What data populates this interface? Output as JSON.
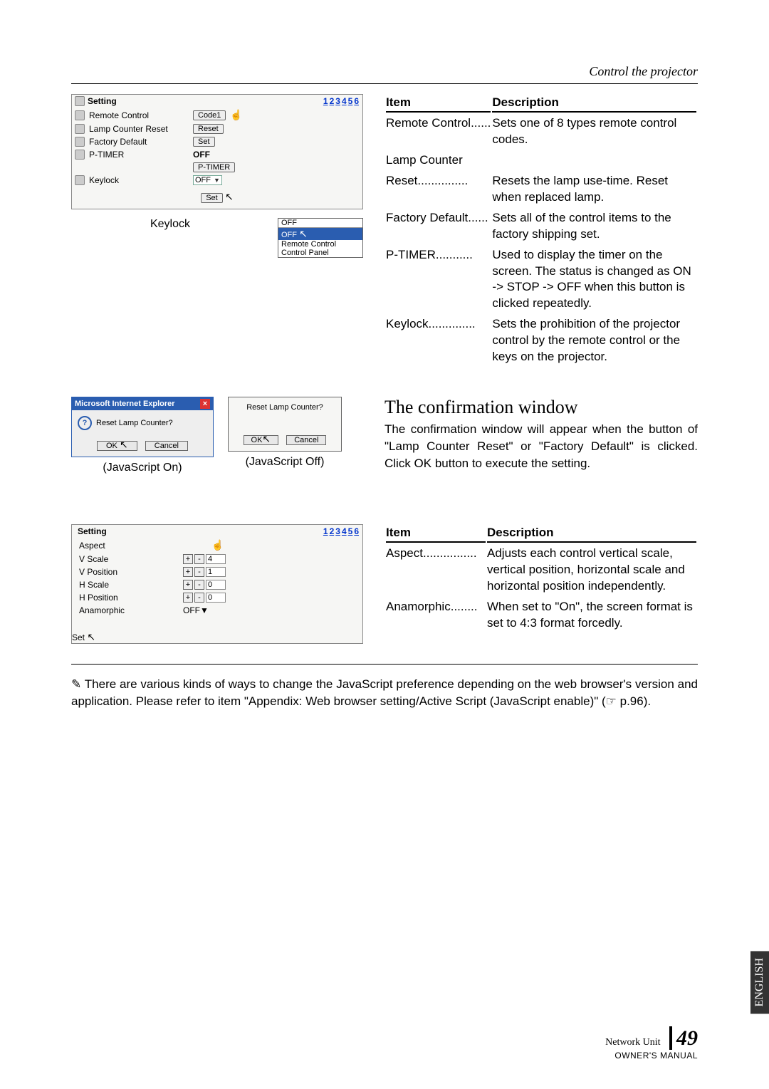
{
  "header": {
    "section": "Control the projector"
  },
  "shot1": {
    "title": "Setting",
    "pages": [
      "1",
      "2",
      "3",
      "4",
      "5",
      "6"
    ],
    "rows": {
      "remote_control": {
        "label": "Remote Control",
        "button": "Code1"
      },
      "lamp_counter_reset": {
        "label": "Lamp Counter Reset",
        "button": "Reset"
      },
      "factory_default": {
        "label": "Factory Default",
        "button": "Set"
      },
      "ptimer": {
        "label": "P-TIMER",
        "status": "OFF",
        "button": "P-TIMER"
      },
      "keylock": {
        "label": "Keylock",
        "value": "OFF"
      }
    },
    "set_button": "Set",
    "keylock_sub": {
      "label": "Keylock",
      "selected": "OFF",
      "options": [
        "OFF",
        "OFF",
        "Remote Control",
        "Control Panel"
      ]
    }
  },
  "table1": {
    "head_item": "Item",
    "head_desc": "Description",
    "rows": [
      {
        "item": "Remote Control",
        "dots": "......",
        "desc": "Sets one of 8 types remote control codes."
      },
      {
        "item": "Lamp Counter",
        "dots": "",
        "desc": ""
      },
      {
        "item": "Reset",
        "dots": "...............",
        "desc": "Resets the lamp use-time. Reset when replaced lamp."
      },
      {
        "item": "Factory Default",
        "dots": "......",
        "desc": "Sets all of the control items to the factory shipping set."
      },
      {
        "item": "P-TIMER",
        "dots": "...........",
        "desc": "Used to display the timer on the screen. The status is changed as ON -> STOP -> OFF when this button is clicked repeatedly."
      },
      {
        "item": "Keylock",
        "dots": "..............",
        "desc": "Sets the prohibition of the projector control by the remote control or the keys on the projector."
      }
    ]
  },
  "confirm": {
    "title": "The confirmation window",
    "body": "The confirmation window will appear when the button of \"Lamp Counter Reset\" or \"Factory Default\" is clicked. Click OK button to execute the setting.",
    "dlg_js": {
      "title": "Microsoft Internet Explorer",
      "msg": "Reset Lamp Counter?",
      "ok": "OK",
      "cancel": "Cancel",
      "caption": "(JavaScript On)"
    },
    "dlg_nojs": {
      "msg": "Reset Lamp Counter?",
      "ok": "OK",
      "cancel": "Cancel",
      "caption": "(JavaScript Off)"
    }
  },
  "shot2": {
    "title": "Setting",
    "pages": [
      "1",
      "2",
      "3",
      "4",
      "5",
      "6"
    ],
    "rows": {
      "aspect": {
        "label": "Aspect"
      },
      "vscale": {
        "label": "V Scale",
        "value": "4"
      },
      "vposition": {
        "label": "V Position",
        "value": "1"
      },
      "hscale": {
        "label": "H Scale",
        "value": "0"
      },
      "hposition": {
        "label": "H Position",
        "value": "0"
      },
      "anamorphic": {
        "label": "Anamorphic",
        "value": "OFF"
      }
    },
    "set_button": "Set"
  },
  "table2": {
    "head_item": "Item",
    "head_desc": "Description",
    "rows": [
      {
        "item": "Aspect",
        "dots": "................",
        "desc": "Adjusts each control vertical scale, vertical position, horizontal scale and horizontal position independently."
      },
      {
        "item": "Anamorphic",
        "dots": "........",
        "desc": "When set to \"On\", the screen format is set to 4:3 format forcedly."
      }
    ]
  },
  "footnote": {
    "icon": "✎",
    "text": "There are various kinds of ways to change the JavaScript preference depending on the web browser's version and application. Please refer to item \"Appendix: Web browser setting/Active Script (JavaScript enable)\" (☞ p.96)."
  },
  "lang_tab": "ENGLISH",
  "footer": {
    "unit": "Network Unit",
    "manual": "OWNER'S MANUAL",
    "page": "49"
  }
}
